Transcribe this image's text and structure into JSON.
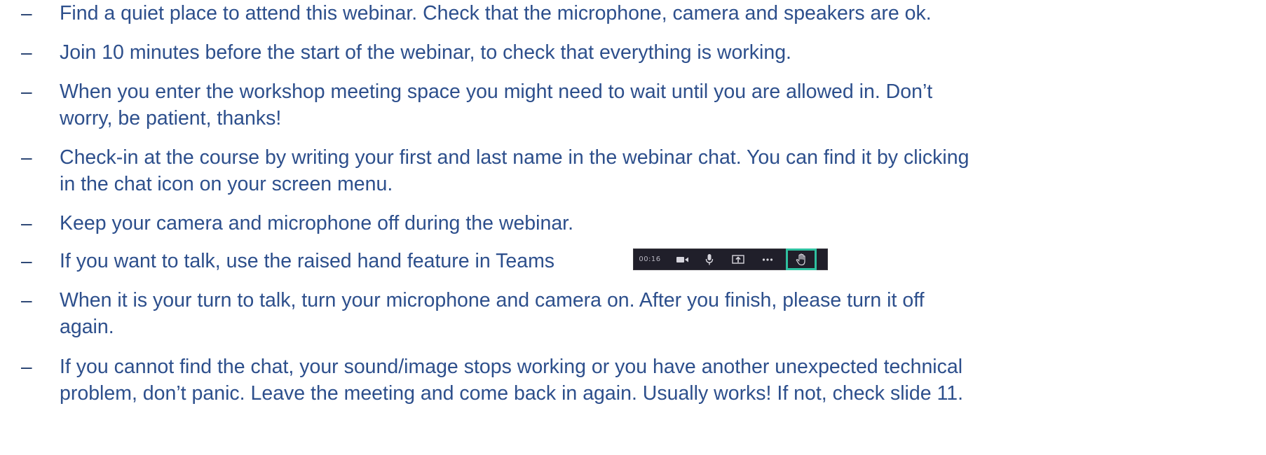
{
  "instructions": [
    {
      "marker": "–",
      "lines": [
        "Find a quiet place to attend this webinar. Check that the microphone, camera and speakers are ok."
      ]
    },
    {
      "marker": "–",
      "lines": [
        "Join 10 minutes before the start of the webinar, to check that everything is working."
      ]
    },
    {
      "marker": "–",
      "lines": [
        "When you enter the workshop meeting space you might need to wait until you are allowed in. Don’t",
        "worry, be patient, thanks!"
      ]
    },
    {
      "marker": "–",
      "lines": [
        "Check-in at the course by writing your first and last name in the webinar chat. You can find it by clicking",
        "in the chat icon on your screen menu."
      ]
    },
    {
      "marker": "–",
      "lines": [
        "Keep your camera and microphone off during the webinar."
      ]
    },
    {
      "marker": "–",
      "lines": [
        "If you want to talk, use the raised hand feature in Teams"
      ]
    },
    {
      "marker": "–",
      "lines": [
        "When it is your turn to talk, turn your microphone and camera on. After you finish, please turn it off",
        "again."
      ]
    },
    {
      "marker": "–",
      "lines": [
        "If you cannot find the chat, your sound/image stops working or you have another unexpected technical",
        "problem, don’t panic. Leave the meeting and come back in again. Usually works! If not, check slide 11."
      ]
    }
  ],
  "teams_toolbar": {
    "timer": "00:16",
    "icons": [
      "video-camera-icon",
      "microphone-icon",
      "share-screen-icon",
      "more-options-icon",
      "raise-hand-icon"
    ],
    "highlight_color": "#2fc1a0",
    "background_color": "#201f2a"
  },
  "colors": {
    "text": "#2d4f8c",
    "dash": "#1f3b6b"
  }
}
